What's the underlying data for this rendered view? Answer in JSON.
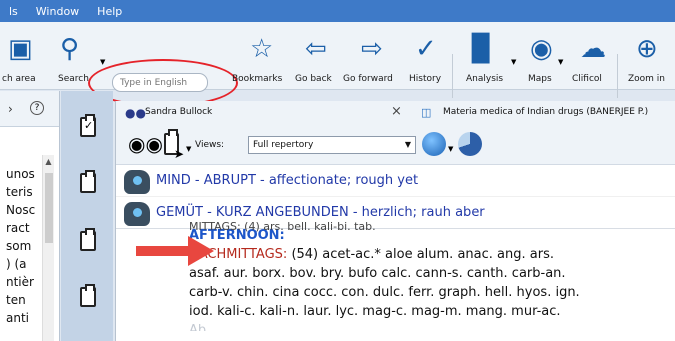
{
  "menu": {
    "items": [
      "ls",
      "Window",
      "Help"
    ]
  },
  "toolbar": {
    "search_area_label": "ch area",
    "search_label": "Search",
    "search_placeholder": "Type in English",
    "bookmarks_label": "Bookmarks",
    "go_back_label": "Go back",
    "go_forward_label": "Go forward",
    "history_label": "History",
    "analysis_label": "Analysis",
    "maps_label": "Maps",
    "clificol_label": "Clificol",
    "zoom_label": "Zoom in"
  },
  "leftpane": {
    "help_glyph": "?",
    "items": [
      "unos",
      "teris",
      "Nosc",
      "ract",
      "som",
      ") (a",
      "ntièr",
      "ten",
      "anti"
    ]
  },
  "tabs": {
    "tab1": "Sandra Bullock",
    "tab1_close": "×",
    "tab2": "Materia medica of Indian drugs (BANERJEE P.)"
  },
  "views": {
    "label": "Views:",
    "selected": "Full repertory"
  },
  "rubrics": [
    {
      "text": "MIND - ABRUPT - affectionate; rough yet"
    },
    {
      "text": "GEMÜT - KURZ ANGEBUNDEN - herzlich; rauh aber"
    }
  ],
  "content": {
    "cut_line": "MITTAGS: (4) ars. bell. kali-bi. tab.",
    "heading_en": "AFTERNOON:",
    "heading_de": "NACHMITTAGS:",
    "line1_rest": " (54) acet-ac.* aloe alum. anac. ang. ars.",
    "line2": "asaf. aur. borx. bov. bry. bufo calc. cann-s. canth. carb-an.",
    "line3": "carb-v. chin. cina cocc. con. dulc. ferr. graph. hell. hyos. ign.",
    "line4": "iod. kali-c. kali-n. laur. lyc. mag-c. mag-m. mang. mur-ac.",
    "line5": "Ab..."
  },
  "colors": {
    "menubar": "#3e7ac8",
    "rubric_text": "#2239a8",
    "english": "#1d56c9",
    "german": "#b52a1e",
    "highlight": "#e5232a"
  }
}
